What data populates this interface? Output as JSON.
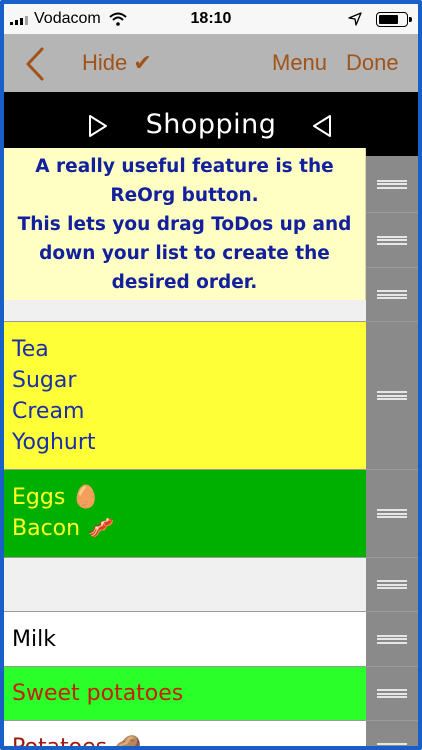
{
  "status": {
    "carrier": "Vodacom",
    "time": "18:10",
    "battery_level": 0.75
  },
  "nav": {
    "hide_label": "Hide ✔",
    "menu_label": "Menu",
    "done_label": "Done",
    "accent": "#a0541a"
  },
  "list_title": "Shopping",
  "tooltip": {
    "lines": [
      "A really useful feature is the",
      "ReOrg button.",
      "This lets you drag ToDos up and",
      "down your list to create the",
      "desired order."
    ]
  },
  "rows": [
    {
      "text": "",
      "bg": "#f0f0f0",
      "color": "#000000"
    },
    {
      "text": "",
      "bg": "#f0f0f0",
      "color": "#000000"
    },
    {
      "text": "",
      "bg": "#f0f0f0",
      "color": "#000000"
    },
    {
      "text": "Tea\nSugar\nCream\nYoghurt",
      "bg": "#ffff38",
      "color": "#1a2fa8"
    },
    {
      "text": "Eggs 🥚\nBacon 🥓",
      "bg": "#00b000",
      "color": "#ffff2a"
    },
    {
      "text": "",
      "bg": "#f0f0f0",
      "color": "#000000"
    },
    {
      "text": "Milk",
      "bg": "#ffffff",
      "color": "#000000"
    },
    {
      "text": "Sweet potatoes",
      "bg": "#2aff2a",
      "color": "#c81e0a"
    },
    {
      "text": "Potatoes 🥔",
      "bg": "#ffffff",
      "color": "#a01a0a"
    }
  ]
}
